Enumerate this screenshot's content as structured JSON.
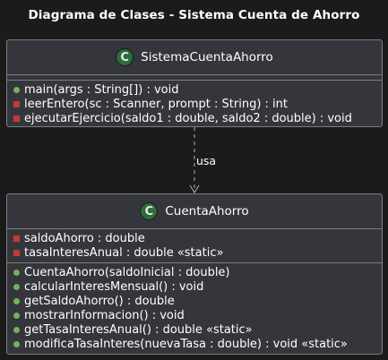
{
  "title": "Diagrama de Clases - Sistema Cuenta de Ahorro",
  "classes": {
    "sistema": {
      "stereotype": "C",
      "name": "SistemaCuentaAhorro",
      "methods": [
        {
          "visibility": "public",
          "text": "main(args : String[]) : void"
        },
        {
          "visibility": "private",
          "text": "leerEntero(sc : Scanner, prompt : String) : int"
        },
        {
          "visibility": "private",
          "text": "ejecutarEjercicio(saldo1 : double, saldo2 : double) : void"
        }
      ]
    },
    "cuenta": {
      "stereotype": "C",
      "name": "CuentaAhorro",
      "attributes": [
        {
          "visibility": "private",
          "text": "saldoAhorro : double"
        },
        {
          "visibility": "private",
          "text": "tasaInteresAnual : double «static»"
        }
      ],
      "methods": [
        {
          "visibility": "public",
          "text": "CuentaAhorro(saldoInicial : double)"
        },
        {
          "visibility": "public",
          "text": "calcularInteresMensual() : void"
        },
        {
          "visibility": "public",
          "text": "getSaldoAhorro() : double"
        },
        {
          "visibility": "public",
          "text": "mostrarInformacion() : void"
        },
        {
          "visibility": "public",
          "text": "getTasaInteresAnual() : double «static»"
        },
        {
          "visibility": "public",
          "text": "modificaTasaInteres(nuevaTasa : double) : void «static»"
        }
      ]
    }
  },
  "relation": {
    "label": "usa"
  },
  "colors": {
    "background": "#1b1b1b",
    "class_fill": "#35363b",
    "class_border": "#7d7d80",
    "stereotype_circle": "#2e6b3a",
    "public_marker": "#6fb35a",
    "private_marker": "#c33838",
    "arrow": "#b0b0b0"
  }
}
